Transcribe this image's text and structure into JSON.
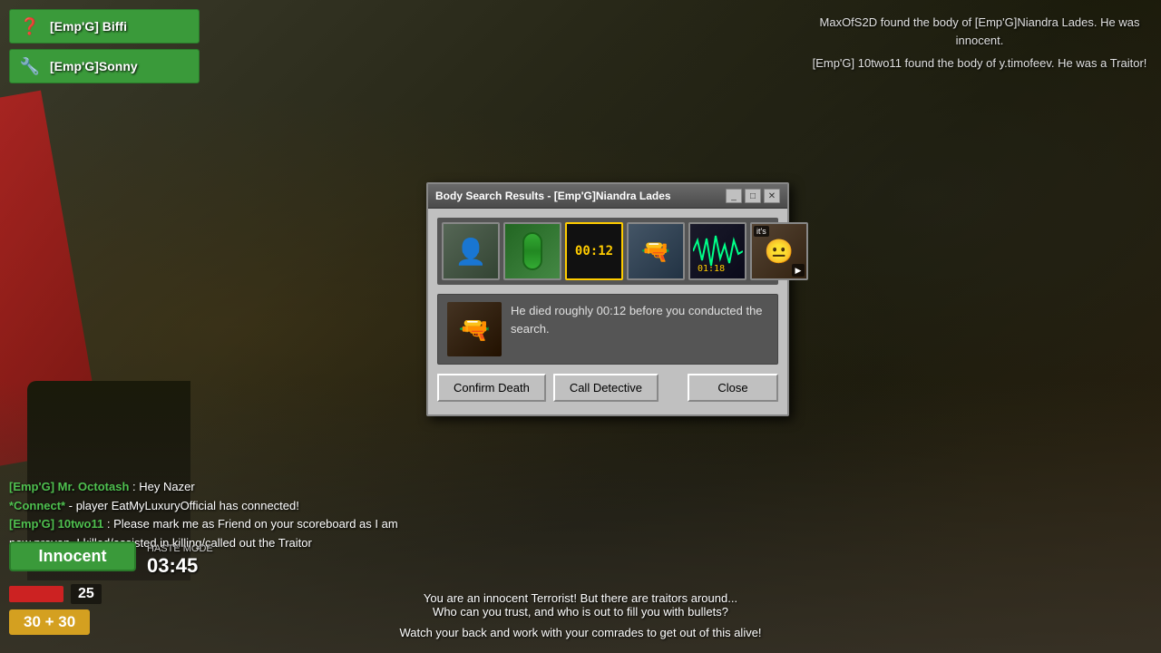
{
  "window": {
    "title": "Body Search Results - [Emp'G]Niandra Lades"
  },
  "notifications": [
    {
      "text": "MaxOfS2D found the body of [Emp'G]Niandra Lades. He was innocent."
    },
    {
      "text": "[Emp'G] 10two11 found the body of y.timofeev. He was a Traitor!"
    }
  ],
  "players": [
    {
      "name": "[Emp'G] Biffi",
      "icon": "❓"
    },
    {
      "name": "[Emp'G]Sonny",
      "icon": "🔧"
    }
  ],
  "evidence": [
    {
      "type": "avatar",
      "label": "player-avatar"
    },
    {
      "type": "pill",
      "label": "role-indicator"
    },
    {
      "type": "timer",
      "value": "00:12",
      "label": "time-of-death",
      "highlighted": true
    },
    {
      "type": "gun",
      "label": "weapon"
    },
    {
      "type": "wave",
      "value": "01:18",
      "label": "evidence-wave"
    },
    {
      "type": "face",
      "label": "witness",
      "badge": "it's",
      "has_play": true
    }
  ],
  "death_description": "He died roughly 00:12 before you conducted the search.",
  "buttons": {
    "confirm_death": "Confirm Death",
    "call_detective": "Call Detective",
    "close": "Close"
  },
  "chat": [
    {
      "name": "[Emp'G] Mr. Octotash",
      "message": ": Hey Nazer",
      "name_color": "#4fc04f"
    },
    {
      "name": "*Connect*",
      "message": " - player EatMyLuxuryOfficial has connected!",
      "name_color": "#4fc04f"
    },
    {
      "name": "[Emp'G] 10two11",
      "message": ": Please mark me as Friend on your scoreboard as I am now proven. I killed/assisted in killing/called out the Traitor",
      "name_color": "#4fc04f"
    }
  ],
  "status": {
    "role": "Innocent",
    "haste_label": "HASTE MODE",
    "haste_time": "03:45",
    "health": 25,
    "ammo": "30 + 30"
  },
  "bottom_message": {
    "line1": "You are an innocent Terrorist! But there are traitors around...",
    "line2": "Who can you trust, and who is out to fill you with bullets?",
    "line3": "",
    "line4": "Watch your back and work with your comrades to get out of this alive!"
  }
}
